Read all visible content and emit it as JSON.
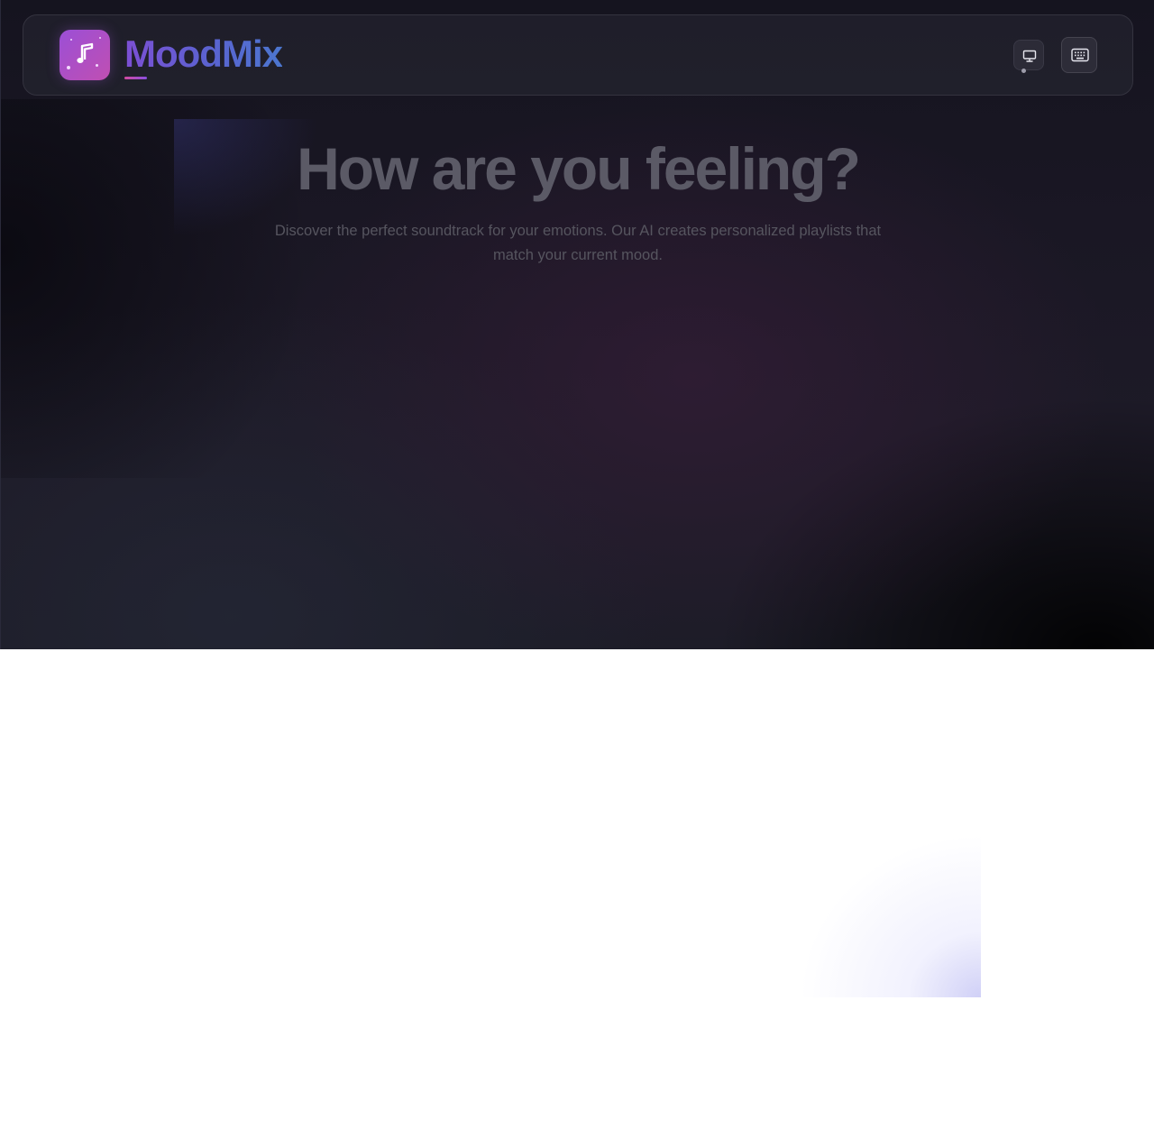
{
  "app": {
    "name": "MoodMix"
  },
  "navbar": {
    "logo_icon": "music-note-icon",
    "display_button_icon": "monitor-icon",
    "keyboard_button_icon": "keyboard-icon"
  },
  "hero": {
    "title": "How are you feeling?",
    "subtitle": "Discover the perfect soundtrack for your emotions. Our AI creates personalized playlists that match your current mood."
  },
  "colors": {
    "brand_gradient_start": "#7c4fd4",
    "brand_gradient_end": "#4c76cf",
    "logo_tile_start": "#9b4fd6",
    "logo_tile_end": "#c04fb2",
    "background_dark": "#1a1724"
  }
}
